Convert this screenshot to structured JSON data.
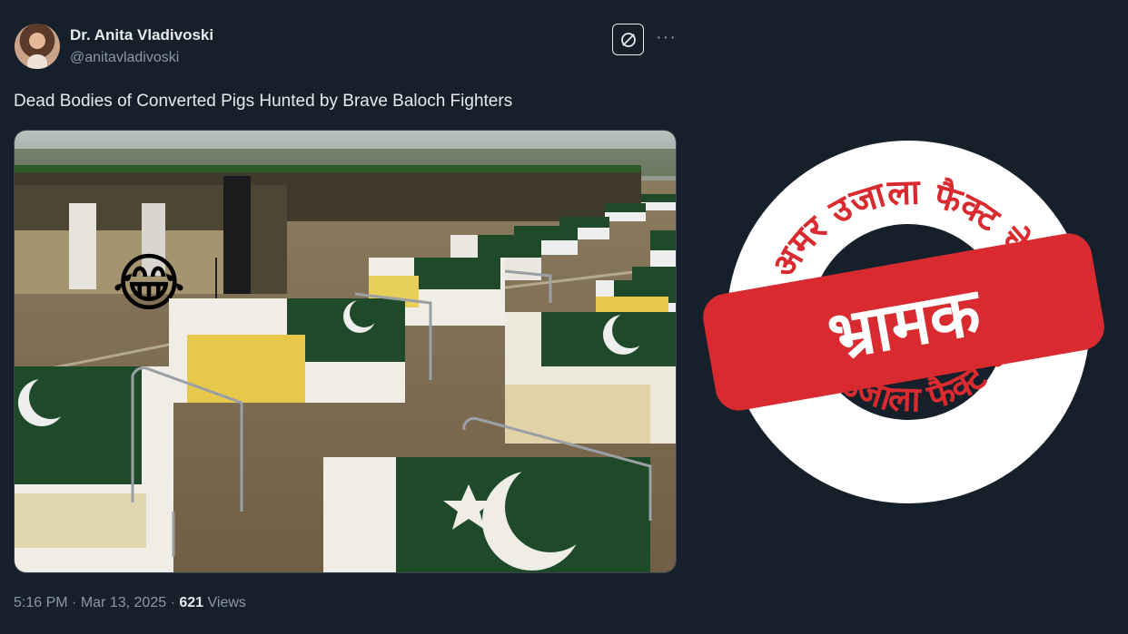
{
  "author": {
    "display_name": "Dr. Anita Vladivoski",
    "handle": "@anitavladivoski"
  },
  "tweet": {
    "text": "Dead Bodies of Converted Pigs Hunted by Brave Baloch Fighters"
  },
  "meta": {
    "time": "5:16 PM",
    "separator": "·",
    "date": "Mar 13, 2025",
    "views_count": "621",
    "views_label": "Views"
  },
  "media": {
    "emoji": "😂"
  },
  "stamp": {
    "top_arc": "अमर उजाला फैक्ट चेक",
    "bottom_arc": "अमर उजाला फैक्ट चेक",
    "verdict": "भ्रामक"
  },
  "colors": {
    "background": "#15202b",
    "stamp_red": "#d82a2f",
    "flag_green": "#1f4a2a"
  },
  "icons": {
    "more": "more-horizontal-icon",
    "grok": "grok-icon"
  }
}
